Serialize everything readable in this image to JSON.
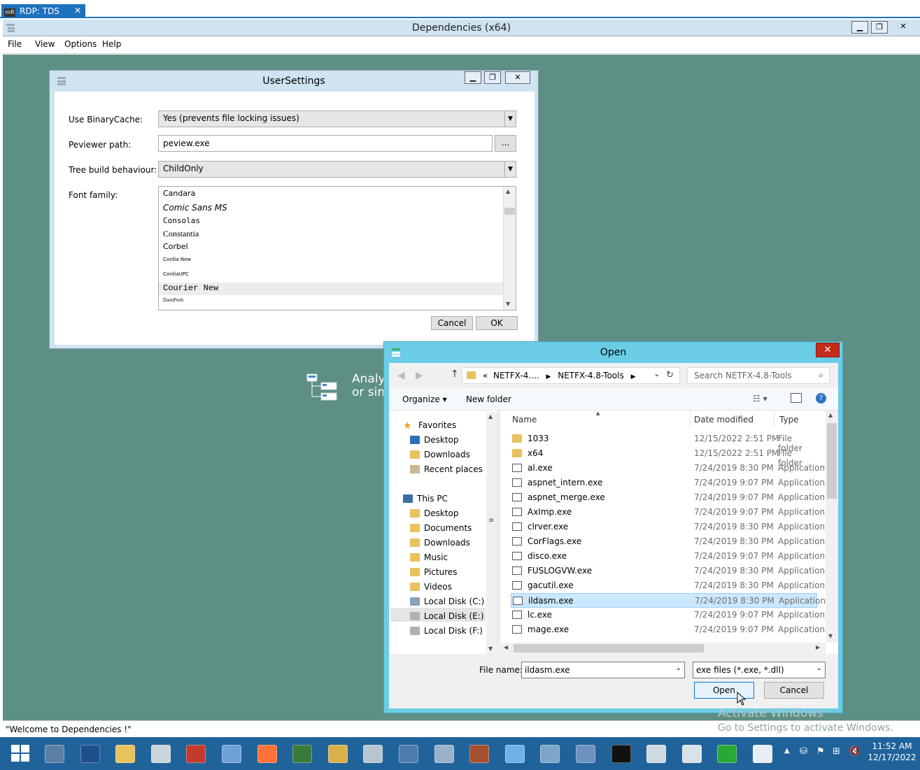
{
  "rdp": {
    "logo": "mR",
    "tab_label": "RDP: TDS",
    "close": "✕"
  },
  "main_window": {
    "title": "Dependencies (x64)",
    "controls": {
      "minimize": "▁",
      "restore": "❐",
      "close": "✕"
    },
    "menu": [
      "File",
      "View",
      "Options",
      "Help"
    ],
    "status": "\"Welcome to Dependencies !\"",
    "background_text": [
      "Analy",
      "or sim"
    ]
  },
  "user_settings": {
    "title": "UserSettings",
    "controls": {
      "minimize": "▁",
      "restore": "❐",
      "close": "✕"
    },
    "use_binarycache_label": "Use BinaryCache:",
    "use_binarycache_value": "Yes (prevents file locking issues)",
    "peviewer_label": "Peviewer path:",
    "peviewer_value": "peview.exe",
    "browse_label": "...",
    "tree_label": "Tree build behaviour:",
    "tree_value": "ChildOnly",
    "font_label": "Font family:",
    "fonts": [
      "Candara",
      "Comic Sans MS",
      "Consolas",
      "Constantia",
      "Corbel",
      "Cordia New",
      "CordiaUPC",
      "Courier New",
      "DaunPenh"
    ],
    "cancel": "Cancel",
    "ok": "OK"
  },
  "open_dialog": {
    "title": "Open",
    "close": "✕",
    "breadcrumb": [
      "«",
      "NETFX-4....",
      "NETFX-4.8-Tools"
    ],
    "search_placeholder": "Search NETFX-4.8-Tools",
    "organize": "Organize ▾",
    "new_folder": "New folder",
    "nav": {
      "favorites": "Favorites",
      "fav_items": [
        "Desktop",
        "Downloads",
        "Recent places"
      ],
      "this_pc": "This PC",
      "pc_items": [
        "Desktop",
        "Documents",
        "Downloads",
        "Music",
        "Pictures",
        "Videos",
        "Local Disk (C:)",
        "Local Disk (E:)",
        "Local Disk (F:)"
      ]
    },
    "columns": {
      "name": "Name",
      "date": "Date modified",
      "type": "Type"
    },
    "files": [
      {
        "name": "1033",
        "date": "12/15/2022 2:51 PM",
        "type": "File folder"
      },
      {
        "name": "x64",
        "date": "12/15/2022 2:51 PM",
        "type": "File folder"
      },
      {
        "name": "al.exe",
        "date": "7/24/2019 8:30 PM",
        "type": "Application"
      },
      {
        "name": "aspnet_intern.exe",
        "date": "7/24/2019 9:07 PM",
        "type": "Application"
      },
      {
        "name": "aspnet_merge.exe",
        "date": "7/24/2019 9:07 PM",
        "type": "Application"
      },
      {
        "name": "AxImp.exe",
        "date": "7/24/2019 9:07 PM",
        "type": "Application"
      },
      {
        "name": "clrver.exe",
        "date": "7/24/2019 8:30 PM",
        "type": "Application"
      },
      {
        "name": "CorFlags.exe",
        "date": "7/24/2019 8:30 PM",
        "type": "Application"
      },
      {
        "name": "disco.exe",
        "date": "7/24/2019 9:07 PM",
        "type": "Application"
      },
      {
        "name": "FUSLOGVW.exe",
        "date": "7/24/2019 8:30 PM",
        "type": "Application"
      },
      {
        "name": "gacutil.exe",
        "date": "7/24/2019 8:30 PM",
        "type": "Application"
      },
      {
        "name": "ildasm.exe",
        "date": "7/24/2019 8:30 PM",
        "type": "Application"
      },
      {
        "name": "lc.exe",
        "date": "7/24/2019 9:07 PM",
        "type": "Application"
      },
      {
        "name": "mage.exe",
        "date": "7/24/2019 9:07 PM",
        "type": "Application"
      }
    ],
    "selected_file": "ildasm.exe",
    "file_name_label": "File name:",
    "file_name_value": "ildasm.exe",
    "filter": "exe files (*.exe, *.dll)",
    "open_btn": "Open",
    "cancel_btn": "Cancel"
  },
  "watermark": {
    "line1": "Activate Windows",
    "line2": "Go to Settings to activate Windows."
  },
  "taskbar": {
    "start_icon": "windows-start",
    "clock_time": "11:52 AM",
    "clock_date": "12/17/2022",
    "accent": "#1e73be",
    "selected_row": "#cce8ff"
  }
}
